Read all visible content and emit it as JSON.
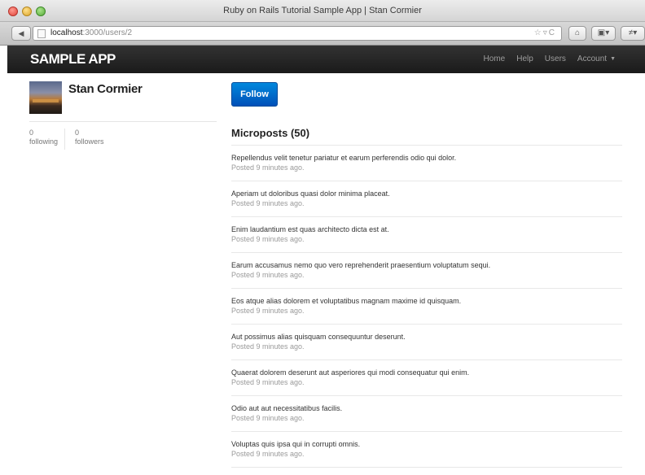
{
  "window": {
    "title": "Ruby on Rails Tutorial Sample App | Stan Cormier",
    "url_host": "localhost",
    "url_path": ":3000/users/2"
  },
  "navbar": {
    "logo": "SAMPLE APP",
    "links": [
      "Home",
      "Help",
      "Users",
      "Account"
    ]
  },
  "user": {
    "name": "Stan Cormier",
    "following_count": "0",
    "following_label": "following",
    "followers_count": "0",
    "followers_label": "followers",
    "avatar_icon": "user-avatar-photo"
  },
  "follow_button": "Follow",
  "microposts": {
    "heading": "Microposts",
    "count": "(50)",
    "items": [
      {
        "content": "Repellendus velit tenetur pariatur et earum perferendis odio qui dolor.",
        "timestamp": "Posted 9 minutes ago."
      },
      {
        "content": "Aperiam ut doloribus quasi dolor minima placeat.",
        "timestamp": "Posted 9 minutes ago."
      },
      {
        "content": "Enim laudantium est quas architecto dicta est at.",
        "timestamp": "Posted 9 minutes ago."
      },
      {
        "content": "Earum accusamus nemo quo vero reprehenderit praesentium voluptatum sequi.",
        "timestamp": "Posted 9 minutes ago."
      },
      {
        "content": "Eos atque alias dolorem et voluptatibus magnam maxime id quisquam.",
        "timestamp": "Posted 9 minutes ago."
      },
      {
        "content": "Aut possimus alias quisquam consequuntur deserunt.",
        "timestamp": "Posted 9 minutes ago."
      },
      {
        "content": "Quaerat dolorem deserunt aut asperiores qui modi consequatur qui enim.",
        "timestamp": "Posted 9 minutes ago."
      },
      {
        "content": "Odio aut aut necessitatibus facilis.",
        "timestamp": "Posted 9 minutes ago."
      },
      {
        "content": "Voluptas quis ipsa qui in corrupti omnis.",
        "timestamp": "Posted 9 minutes ago."
      }
    ]
  },
  "colors": {
    "navbar_bg": "#222222",
    "follow_button": "#0063cc",
    "link_muted": "#9d9d9d"
  }
}
